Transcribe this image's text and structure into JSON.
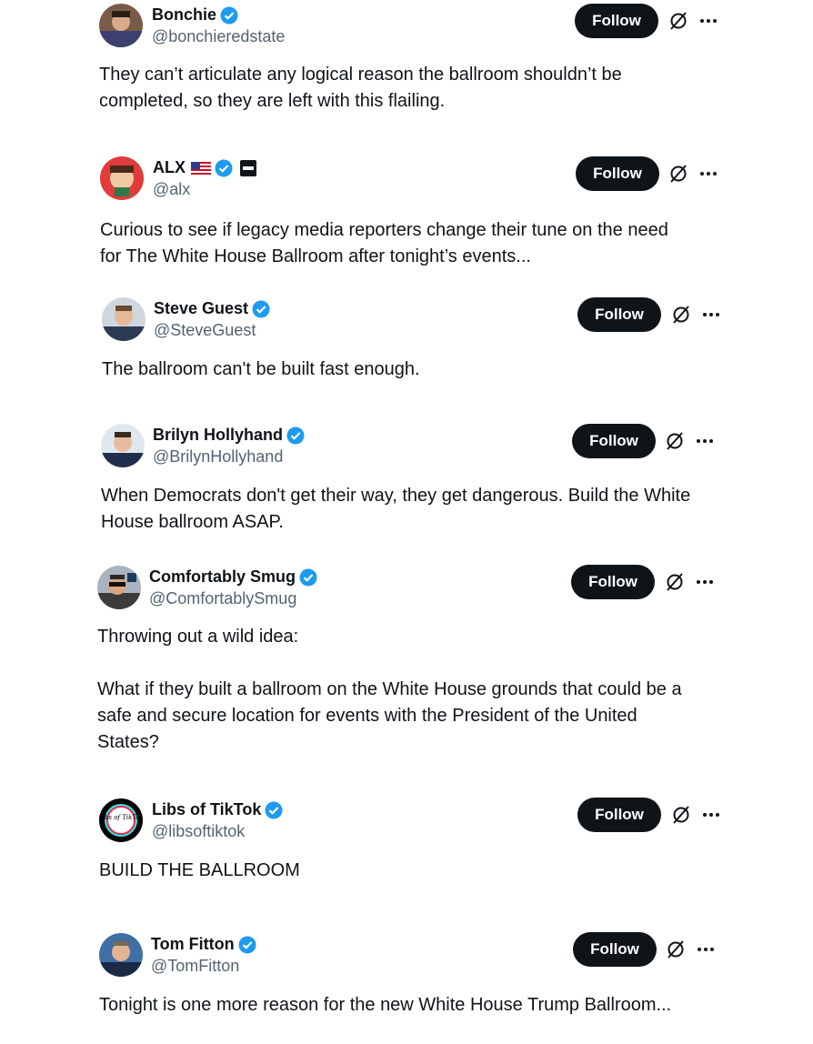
{
  "colors": {
    "accent_verified": "#1d9bf0",
    "text_primary": "#0f1419",
    "text_secondary": "#536471",
    "button_bg": "#0f1419"
  },
  "icons": {
    "verified": "verified-badge-icon",
    "grok": "grok-icon",
    "more": "more-dots-icon"
  },
  "follow_label": "Follow",
  "tweets": [
    {
      "name": "Bonchie",
      "handle": "@bonchieredstate",
      "text": "They can’t articulate any logical reason the ballroom shouldn’t be\ncompleted, so they are left with this flailing."
    },
    {
      "name": "ALX",
      "handle": "@alx",
      "text": "Curious to see if legacy media reporters change their tune on the need\nfor The White House Ballroom after tonight’s events..."
    },
    {
      "name": "Steve Guest",
      "handle": "@SteveGuest",
      "text": "The ballroom can't be built fast enough."
    },
    {
      "name": "Brilyn Hollyhand",
      "handle": "@BrilynHollyhand",
      "text": "When Democrats don't get their way, they get dangerous. Build the White\nHouse ballroom ASAP."
    },
    {
      "name": "Comfortably Smug",
      "handle": "@ComfortablySmug",
      "text": "Throwing out a wild idea:\n\nWhat if they built a ballroom on the White House grounds that could be a\nsafe and secure location for events with the President of the United\nStates?"
    },
    {
      "name": "Libs of TikTok",
      "handle": "@libsoftiktok",
      "text": "BUILD THE BALLROOM",
      "avatar_text": "Libs of TikTok"
    },
    {
      "name": "Tom Fitton",
      "handle": "@TomFitton",
      "text": "Tonight is one more reason for the new White House Trump Ballroom..."
    }
  ]
}
